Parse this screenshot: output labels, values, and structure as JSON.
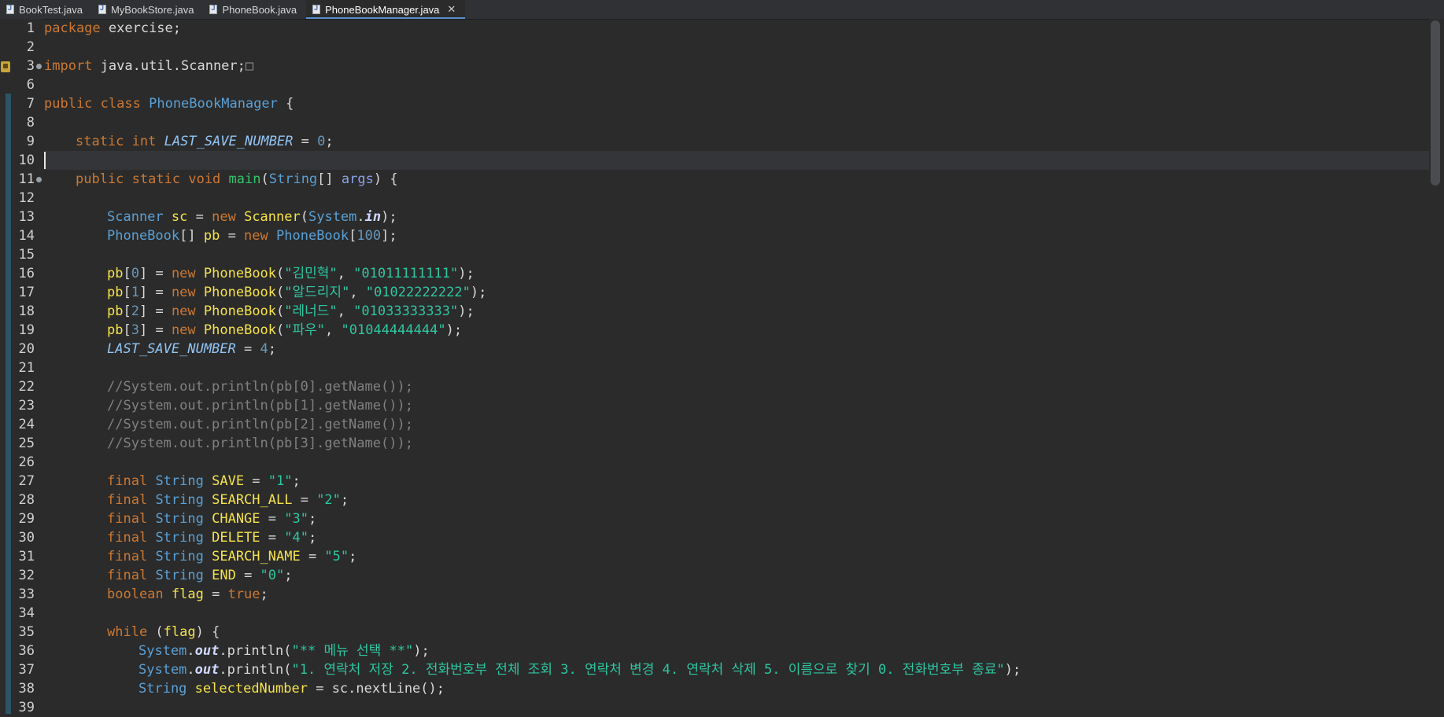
{
  "tabs": [
    {
      "label": "BookTest.java",
      "active": false
    },
    {
      "label": "MyBookStore.java",
      "active": false
    },
    {
      "label": "PhoneBook.java",
      "active": false
    },
    {
      "label": "PhoneBookManager.java",
      "active": true,
      "closable": true
    }
  ],
  "editor": {
    "current_line": 10,
    "line_numbers": [
      "1",
      "2",
      "3",
      "6",
      "7",
      "8",
      "9",
      "10",
      "11",
      "12",
      "13",
      "14",
      "15",
      "16",
      "17",
      "18",
      "19",
      "20",
      "21",
      "22",
      "23",
      "24",
      "25",
      "26",
      "27",
      "28",
      "29",
      "30",
      "31",
      "32",
      "33",
      "34",
      "35",
      "36",
      "37",
      "38",
      "39"
    ],
    "fold_lines": [
      "3",
      "11"
    ],
    "code": {
      "l1": [
        "package",
        " exercise;"
      ],
      "l3": [
        "import",
        " java.util.Scanner;",
        "□"
      ],
      "l7": [
        "public",
        " ",
        "class",
        " ",
        "PhoneBookManager",
        " {"
      ],
      "l9": [
        "static",
        " ",
        "int",
        " ",
        "LAST_SAVE_NUMBER",
        " = ",
        "0",
        ";"
      ],
      "l11": [
        "public",
        " ",
        "static",
        " ",
        "void",
        " ",
        "main",
        "(",
        "String",
        "[] ",
        "args",
        ") {"
      ],
      "l13": [
        "Scanner",
        " ",
        "sc",
        " = ",
        "new",
        " ",
        "Scanner",
        "(",
        "System",
        ".",
        "in",
        ");"
      ],
      "l14": [
        "PhoneBook",
        "[] ",
        "pb",
        " = ",
        "new",
        " ",
        "PhoneBook",
        "[",
        "100",
        "];"
      ],
      "l16": [
        "pb",
        "[",
        "0",
        "] = ",
        "new",
        " ",
        "PhoneBook",
        "(",
        "\"김민혁\"",
        ", ",
        "\"01011111111\"",
        ");"
      ],
      "l17": [
        "pb",
        "[",
        "1",
        "] = ",
        "new",
        " ",
        "PhoneBook",
        "(",
        "\"알드리지\"",
        ", ",
        "\"01022222222\"",
        ");"
      ],
      "l18": [
        "pb",
        "[",
        "2",
        "] = ",
        "new",
        " ",
        "PhoneBook",
        "(",
        "\"레너드\"",
        ", ",
        "\"01033333333\"",
        ");"
      ],
      "l19": [
        "pb",
        "[",
        "3",
        "] = ",
        "new",
        " ",
        "PhoneBook",
        "(",
        "\"파우\"",
        ", ",
        "\"01044444444\"",
        ");"
      ],
      "l20": [
        "LAST_SAVE_NUMBER",
        " = ",
        "4",
        ";"
      ],
      "l22": "//System.out.println(pb[0].getName());",
      "l23": "//System.out.println(pb[1].getName());",
      "l24": "//System.out.println(pb[2].getName());",
      "l25": "//System.out.println(pb[3].getName());",
      "l27": [
        "final",
        " ",
        "String",
        " ",
        "SAVE",
        " = ",
        "\"1\"",
        ";"
      ],
      "l28": [
        "final",
        " ",
        "String",
        " ",
        "SEARCH_ALL",
        " = ",
        "\"2\"",
        ";"
      ],
      "l29": [
        "final",
        " ",
        "String",
        " ",
        "CHANGE",
        " = ",
        "\"3\"",
        ";"
      ],
      "l30": [
        "final",
        " ",
        "String",
        " ",
        "DELETE",
        " = ",
        "\"4\"",
        ";"
      ],
      "l31": [
        "final",
        " ",
        "String",
        " ",
        "SEARCH_NAME",
        " = ",
        "\"5\"",
        ";"
      ],
      "l32": [
        "final",
        " ",
        "String",
        " ",
        "END",
        " = ",
        "\"0\"",
        ";"
      ],
      "l33": [
        "boolean",
        " ",
        "flag",
        " = ",
        "true",
        ";"
      ],
      "l35": [
        "while",
        " (",
        "flag",
        ") {"
      ],
      "l36": [
        "System",
        ".",
        "out",
        ".println(",
        "\"** 메뉴 선택 **\"",
        ");"
      ],
      "l37": [
        "System",
        ".",
        "out",
        ".println(",
        "\"1. 연락처 저장 2. 전화번호부 전체 조회 3. 연락처 변경 4. 연락처 삭제 5. 이름으로 찾기 0. 전화번호부 종료\"",
        ");"
      ],
      "l38": [
        "String",
        " ",
        "selectedNumber",
        " = ",
        "sc",
        ".nextLine();"
      ]
    }
  },
  "colors": {
    "background": "#2b2b2b",
    "keyword": "#cc7832",
    "type": "#5aa0d6",
    "local_variable": "#f5e24b",
    "string": "#2ec6a0",
    "number": "#6897bb",
    "comment": "#808080",
    "method": "#32c46d",
    "active_tab_accent": "#5a8fd0"
  }
}
